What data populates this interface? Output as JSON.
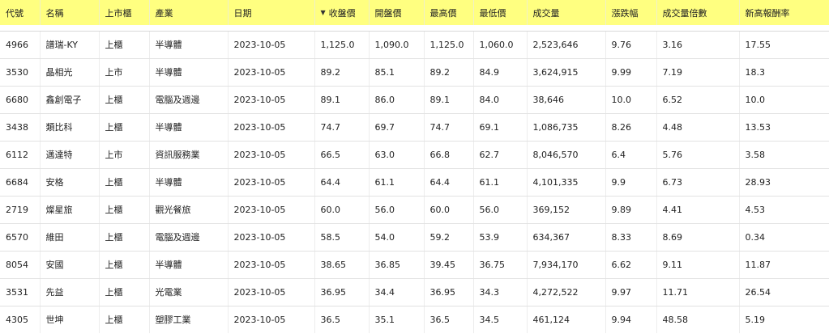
{
  "table": {
    "headers": [
      {
        "key": "code",
        "label": "代號"
      },
      {
        "key": "name",
        "label": "名稱"
      },
      {
        "key": "market",
        "label": "上市櫃"
      },
      {
        "key": "industry",
        "label": "產業"
      },
      {
        "key": "date",
        "label": "日期"
      },
      {
        "key": "close",
        "label": "收盤價",
        "sorted": "desc",
        "sort_icon": "sort-desc-icon"
      },
      {
        "key": "open",
        "label": "開盤價"
      },
      {
        "key": "high",
        "label": "最高價"
      },
      {
        "key": "low",
        "label": "最低價"
      },
      {
        "key": "volume",
        "label": "成交量"
      },
      {
        "key": "change_pct",
        "label": "漲跌幅"
      },
      {
        "key": "volume_ratio",
        "label": "成交量倍數"
      },
      {
        "key": "new_high_return",
        "label": "新高報酬率"
      }
    ],
    "rows": [
      [
        "4966",
        "譜瑞-KY",
        "上櫃",
        "半導體",
        "2023-10-05",
        "1,125.0",
        "1,090.0",
        "1,125.0",
        "1,060.0",
        "2,523,646",
        "9.76",
        "3.16",
        "17.55"
      ],
      [
        "3530",
        "晶相光",
        "上市",
        "半導體",
        "2023-10-05",
        "89.2",
        "85.1",
        "89.2",
        "84.9",
        "3,624,915",
        "9.99",
        "7.19",
        "18.3"
      ],
      [
        "6680",
        "鑫創電子",
        "上櫃",
        "電腦及週邊",
        "2023-10-05",
        "89.1",
        "86.0",
        "89.1",
        "84.0",
        "38,646",
        "10.0",
        "6.52",
        "10.0"
      ],
      [
        "3438",
        "類比科",
        "上櫃",
        "半導體",
        "2023-10-05",
        "74.7",
        "69.7",
        "74.7",
        "69.1",
        "1,086,735",
        "8.26",
        "4.48",
        "13.53"
      ],
      [
        "6112",
        "邁達特",
        "上市",
        "資訊服務業",
        "2023-10-05",
        "66.5",
        "63.0",
        "66.8",
        "62.7",
        "8,046,570",
        "6.4",
        "5.76",
        "3.58"
      ],
      [
        "6684",
        "安格",
        "上櫃",
        "半導體",
        "2023-10-05",
        "64.4",
        "61.1",
        "64.4",
        "61.1",
        "4,101,335",
        "9.9",
        "6.73",
        "28.93"
      ],
      [
        "2719",
        "燦星旅",
        "上櫃",
        "觀光餐旅",
        "2023-10-05",
        "60.0",
        "56.0",
        "60.0",
        "56.0",
        "369,152",
        "9.89",
        "4.41",
        "4.53"
      ],
      [
        "6570",
        "維田",
        "上櫃",
        "電腦及週邊",
        "2023-10-05",
        "58.5",
        "54.0",
        "59.2",
        "53.9",
        "634,367",
        "8.33",
        "8.69",
        "0.34"
      ],
      [
        "8054",
        "安國",
        "上櫃",
        "半導體",
        "2023-10-05",
        "38.65",
        "36.85",
        "39.45",
        "36.75",
        "7,934,170",
        "6.62",
        "9.11",
        "11.87"
      ],
      [
        "3531",
        "先益",
        "上櫃",
        "光電業",
        "2023-10-05",
        "36.95",
        "34.4",
        "36.95",
        "34.3",
        "4,272,522",
        "9.97",
        "11.71",
        "26.54"
      ],
      [
        "4305",
        "世坤",
        "上櫃",
        "塑膠工業",
        "2023-10-05",
        "36.5",
        "35.1",
        "36.5",
        "34.5",
        "461,124",
        "9.94",
        "48.58",
        "5.19"
      ]
    ]
  },
  "colors": {
    "header_bg": "#ffff80",
    "row_border": "#e2e2e2",
    "text": "#222222"
  }
}
